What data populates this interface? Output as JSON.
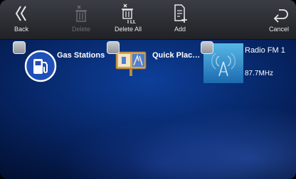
{
  "toolbar": {
    "back_label": "Back",
    "delete_label": "Delete",
    "delete_all_label": "Delete All",
    "add_label": "Add",
    "cancel_label": "Cancel"
  },
  "tiles": [
    {
      "label": "Gas Stations",
      "icon": "gas-station-icon",
      "checked": false
    },
    {
      "label": "Quick Plac…",
      "icon": "map-sign-icon",
      "checked": false
    },
    {
      "label": "Radio FM 1",
      "sublabel": "87.7MHz",
      "icon": "radio-antenna-icon",
      "checked": false
    }
  ],
  "colors": {
    "toolbar": "#2e3036",
    "background": "#0d3f9a",
    "gas_icon": "#1f4fb8",
    "radio_tile": "#2a8fd0"
  }
}
